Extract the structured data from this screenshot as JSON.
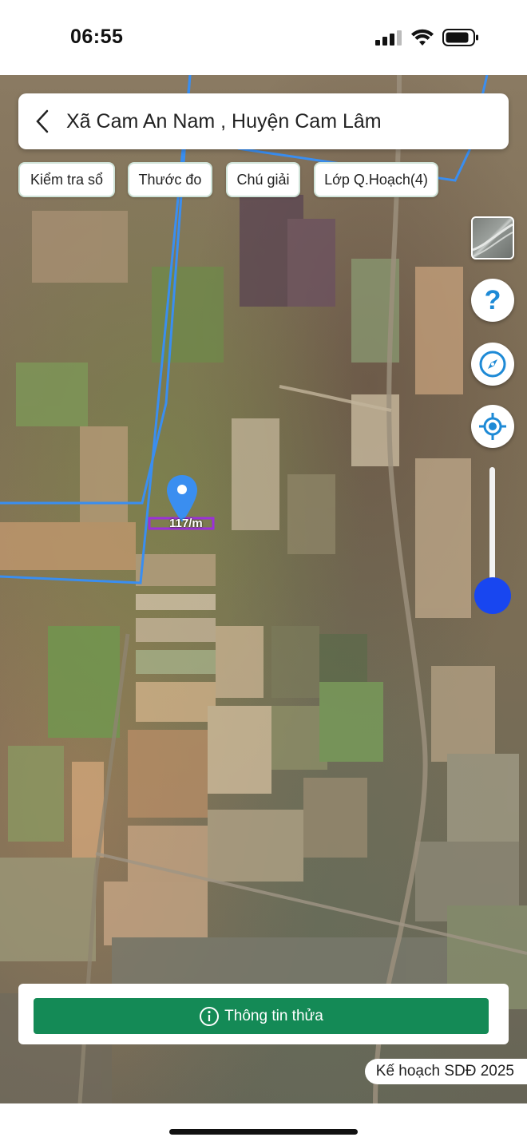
{
  "status_bar": {
    "time": "06:55"
  },
  "search": {
    "location": "Xã Cam An Nam , Huyện Cam Lâm"
  },
  "chips": [
    "Kiểm tra sổ",
    "Thước đo",
    "Chú giải",
    "Lớp Q.Hoạch(4)"
  ],
  "map": {
    "parcel_label": "117/m",
    "zoom_level": 0.15
  },
  "controls": {
    "help_glyph": "?"
  },
  "bottom": {
    "info_button": "Thông tin thửa",
    "plan_badge": "Kế hoạch SDĐ 2025"
  },
  "icons": [
    "back-icon",
    "signal-icon",
    "wifi-icon",
    "battery-icon",
    "layer-icon",
    "help-icon",
    "compass-icon",
    "locate-icon",
    "info-icon",
    "map-pin-icon"
  ],
  "colors": {
    "accent": "#148a56",
    "boundary": "#3a8ef0",
    "parcel": "#9b30d9",
    "slider": "#1846f0",
    "pin": "#3a8ef0"
  }
}
